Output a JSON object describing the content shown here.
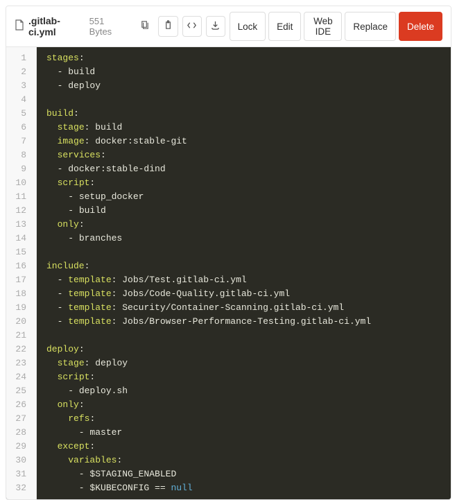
{
  "header": {
    "filename": ".gitlab-ci.yml",
    "filesize": "551 Bytes"
  },
  "buttons": {
    "lock": "Lock",
    "edit": "Edit",
    "webide": "Web IDE",
    "replace": "Replace",
    "delete": "Delete"
  },
  "code": {
    "line_count": 32,
    "lines": [
      [
        [
          "key",
          "stages"
        ],
        [
          "dash",
          ":"
        ]
      ],
      [
        [
          "dash",
          "  - "
        ],
        [
          "str",
          "build"
        ]
      ],
      [
        [
          "dash",
          "  - "
        ],
        [
          "str",
          "deploy"
        ]
      ],
      [],
      [
        [
          "key",
          "build"
        ],
        [
          "dash",
          ":"
        ]
      ],
      [
        [
          "str",
          "  "
        ],
        [
          "key",
          "stage"
        ],
        [
          "dash",
          ": "
        ],
        [
          "str",
          "build"
        ]
      ],
      [
        [
          "str",
          "  "
        ],
        [
          "key",
          "image"
        ],
        [
          "dash",
          ": "
        ],
        [
          "str",
          "docker:stable-git"
        ]
      ],
      [
        [
          "str",
          "  "
        ],
        [
          "key",
          "services"
        ],
        [
          "dash",
          ":"
        ]
      ],
      [
        [
          "dash",
          "  - "
        ],
        [
          "str",
          "docker:stable-dind"
        ]
      ],
      [
        [
          "str",
          "  "
        ],
        [
          "key",
          "script"
        ],
        [
          "dash",
          ":"
        ]
      ],
      [
        [
          "dash",
          "    - "
        ],
        [
          "str",
          "setup_docker"
        ]
      ],
      [
        [
          "dash",
          "    - "
        ],
        [
          "str",
          "build"
        ]
      ],
      [
        [
          "str",
          "  "
        ],
        [
          "key",
          "only"
        ],
        [
          "dash",
          ":"
        ]
      ],
      [
        [
          "dash",
          "    - "
        ],
        [
          "str",
          "branches"
        ]
      ],
      [],
      [
        [
          "key",
          "include"
        ],
        [
          "dash",
          ":"
        ]
      ],
      [
        [
          "dash",
          "  - "
        ],
        [
          "key",
          "template"
        ],
        [
          "dash",
          ": "
        ],
        [
          "str",
          "Jobs/Test.gitlab-ci.yml"
        ]
      ],
      [
        [
          "dash",
          "  - "
        ],
        [
          "key",
          "template"
        ],
        [
          "dash",
          ": "
        ],
        [
          "str",
          "Jobs/Code-Quality.gitlab-ci.yml"
        ]
      ],
      [
        [
          "dash",
          "  - "
        ],
        [
          "key",
          "template"
        ],
        [
          "dash",
          ": "
        ],
        [
          "str",
          "Security/Container-Scanning.gitlab-ci.yml"
        ]
      ],
      [
        [
          "dash",
          "  - "
        ],
        [
          "key",
          "template"
        ],
        [
          "dash",
          ": "
        ],
        [
          "str",
          "Jobs/Browser-Performance-Testing.gitlab-ci.yml"
        ]
      ],
      [],
      [
        [
          "key",
          "deploy"
        ],
        [
          "dash",
          ":"
        ]
      ],
      [
        [
          "str",
          "  "
        ],
        [
          "key",
          "stage"
        ],
        [
          "dash",
          ": "
        ],
        [
          "str",
          "deploy"
        ]
      ],
      [
        [
          "str",
          "  "
        ],
        [
          "key",
          "script"
        ],
        [
          "dash",
          ":"
        ]
      ],
      [
        [
          "dash",
          "    - "
        ],
        [
          "str",
          "deploy.sh"
        ]
      ],
      [
        [
          "str",
          "  "
        ],
        [
          "key",
          "only"
        ],
        [
          "dash",
          ":"
        ]
      ],
      [
        [
          "str",
          "    "
        ],
        [
          "key",
          "refs"
        ],
        [
          "dash",
          ":"
        ]
      ],
      [
        [
          "dash",
          "      - "
        ],
        [
          "str",
          "master"
        ]
      ],
      [
        [
          "str",
          "  "
        ],
        [
          "key",
          "except"
        ],
        [
          "dash",
          ":"
        ]
      ],
      [
        [
          "str",
          "    "
        ],
        [
          "key",
          "variables"
        ],
        [
          "dash",
          ":"
        ]
      ],
      [
        [
          "dash",
          "      - "
        ],
        [
          "str",
          "$STAGING_ENABLED"
        ]
      ],
      [
        [
          "dash",
          "      - "
        ],
        [
          "str",
          "$KUBECONFIG == "
        ],
        [
          "null",
          "null"
        ]
      ]
    ]
  }
}
